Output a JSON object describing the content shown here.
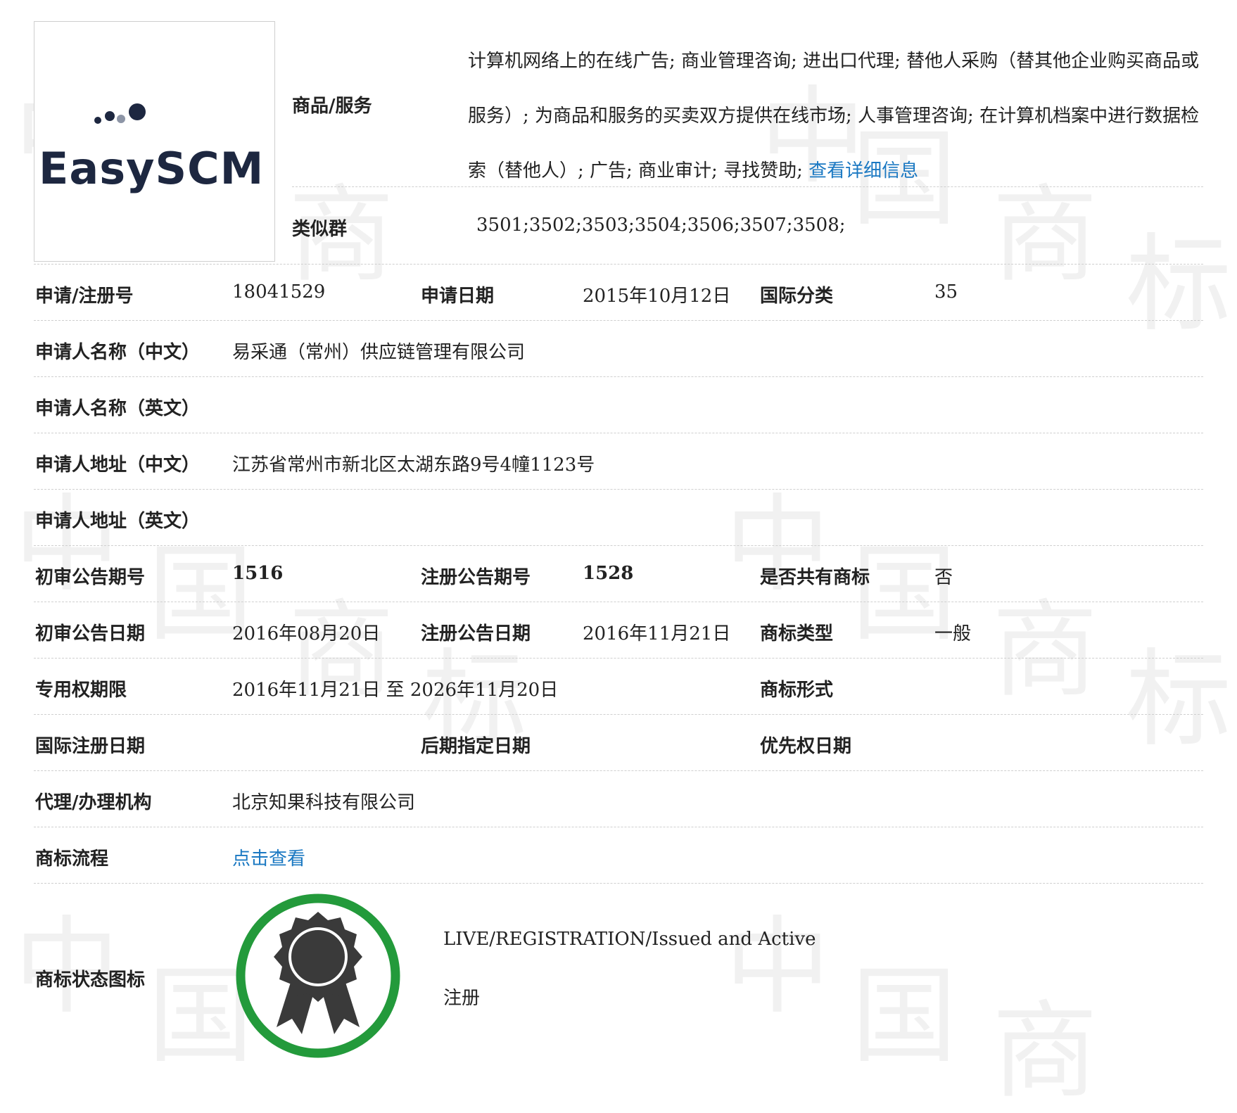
{
  "logo": {
    "text": "EasySCM"
  },
  "goods": {
    "label": "商品/服务",
    "text": "计算机网络上的在线广告; 商业管理咨询; 进出口代理; 替他人采购（替其他企业购买商品或服务）; 为商品和服务的买卖双方提供在线市场; 人事管理咨询; 在计算机档案中进行数据检索（替他人）; 广告; 商业审计; 寻找赞助; ",
    "link": "查看详细信息"
  },
  "similar": {
    "label": "类似群",
    "value": "3501;3502;3503;3504;3506;3507;3508;"
  },
  "rows": {
    "reg_no": {
      "label": "申请/注册号",
      "value": "18041529"
    },
    "app_date": {
      "label": "申请日期",
      "value": "2015年10月12日"
    },
    "intl_class": {
      "label": "国际分类",
      "value": "35"
    },
    "applicant_cn": {
      "label": "申请人名称（中文）",
      "value": "易采通（常州）供应链管理有限公司"
    },
    "applicant_en": {
      "label": "申请人名称（英文）",
      "value": ""
    },
    "address_cn": {
      "label": "申请人地址（中文）",
      "value": "江苏省常州市新北区太湖东路9号4幢1123号"
    },
    "address_en": {
      "label": "申请人地址（英文）",
      "value": ""
    },
    "prelim_no": {
      "label": "初审公告期号",
      "value": "1516"
    },
    "reg_notice_no": {
      "label": "注册公告期号",
      "value": "1528"
    },
    "shared": {
      "label": "是否共有商标",
      "value": "否"
    },
    "prelim_date": {
      "label": "初审公告日期",
      "value": "2016年08月20日"
    },
    "reg_notice_date": {
      "label": "注册公告日期",
      "value": "2016年11月21日"
    },
    "tm_type": {
      "label": "商标类型",
      "value": "一般"
    },
    "exclusive": {
      "label": "专用权期限",
      "value": "2016年11月21日 至 2026年11月20日"
    },
    "tm_form": {
      "label": "商标形式",
      "value": ""
    },
    "intl_reg_date": {
      "label": "国际注册日期",
      "value": ""
    },
    "later_date": {
      "label": "后期指定日期",
      "value": ""
    },
    "priority_date": {
      "label": "优先权日期",
      "value": ""
    },
    "agent": {
      "label": "代理/办理机构",
      "value": "北京知果科技有限公司"
    },
    "process": {
      "label": "商标流程",
      "link": "点击查看"
    },
    "status_icon": {
      "label": "商标状态图标",
      "status_en": "LIVE/REGISTRATION/Issued and Active",
      "status_cn": "注册"
    }
  },
  "colors": {
    "link": "#1a78c2",
    "status_ring": "#239a3b",
    "badge": "#3a3a3a"
  },
  "icons": {
    "status": "award-ribbon-icon"
  }
}
